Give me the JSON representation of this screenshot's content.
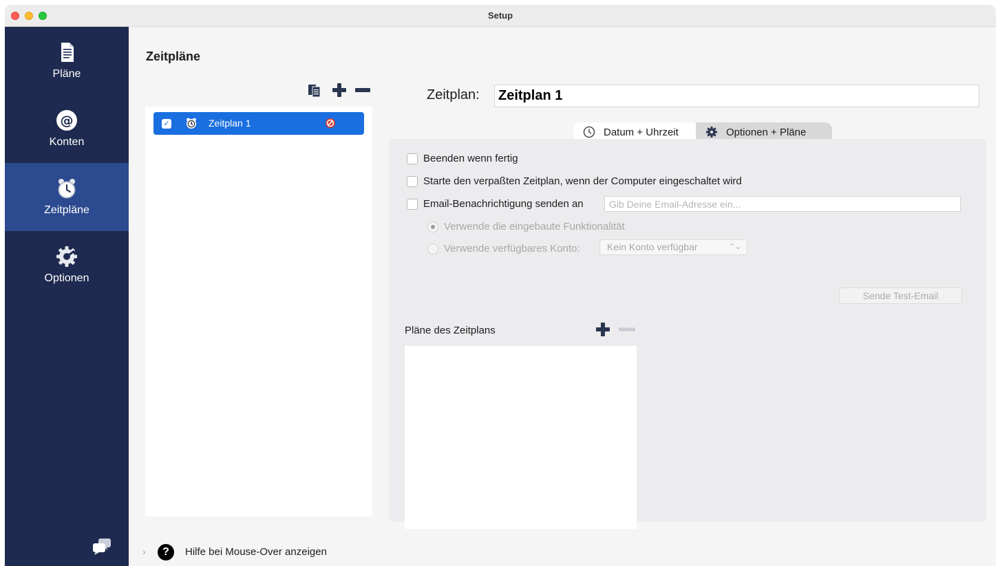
{
  "window": {
    "title": "Setup"
  },
  "sidebar": {
    "items": [
      {
        "label": "Pläne",
        "icon": "document-icon",
        "active": false
      },
      {
        "label": "Konten",
        "icon": "at-sign-icon",
        "active": false
      },
      {
        "label": "Zeitpläne",
        "icon": "alarm-clock-icon",
        "active": true
      },
      {
        "label": "Optionen",
        "icon": "gear-icon",
        "active": false
      }
    ],
    "accent_color": "#2c4a8f",
    "background_color": "#1e2a4f"
  },
  "main": {
    "title": "Zeitpläne",
    "schedule_list": [
      {
        "label": "Zeitplan 1",
        "enabled": true,
        "selected": true
      }
    ],
    "schedule_name_label": "Zeitplan:",
    "schedule_name_value": "Zeitplan 1",
    "tabs": [
      {
        "label": "Datum + Uhrzeit",
        "icon": "clock-icon",
        "active": false
      },
      {
        "label": "Optionen + Pläne",
        "icon": "gear-icon",
        "active": true
      }
    ],
    "options": {
      "quit_when_done": "Beenden wenn fertig",
      "start_missed": "Starte den verpaßten Zeitplan, wenn der Computer eingeschaltet wird",
      "email_notify": "Email-Benachrichtigung senden an",
      "email_placeholder": "Gib Deine Email-Adresse ein...",
      "radio_builtin": "Verwende die eingebaute Funktionalität",
      "radio_account": "Verwende verfügbares Konto:",
      "account_select": "Kein Konto verfügbar",
      "test_email_button": "Sende Test-Email"
    },
    "plans": {
      "title": "Pläne des Zeitplans",
      "items": []
    }
  },
  "footer": {
    "help_label": "Hilfe bei Mouse-Over anzeigen"
  }
}
